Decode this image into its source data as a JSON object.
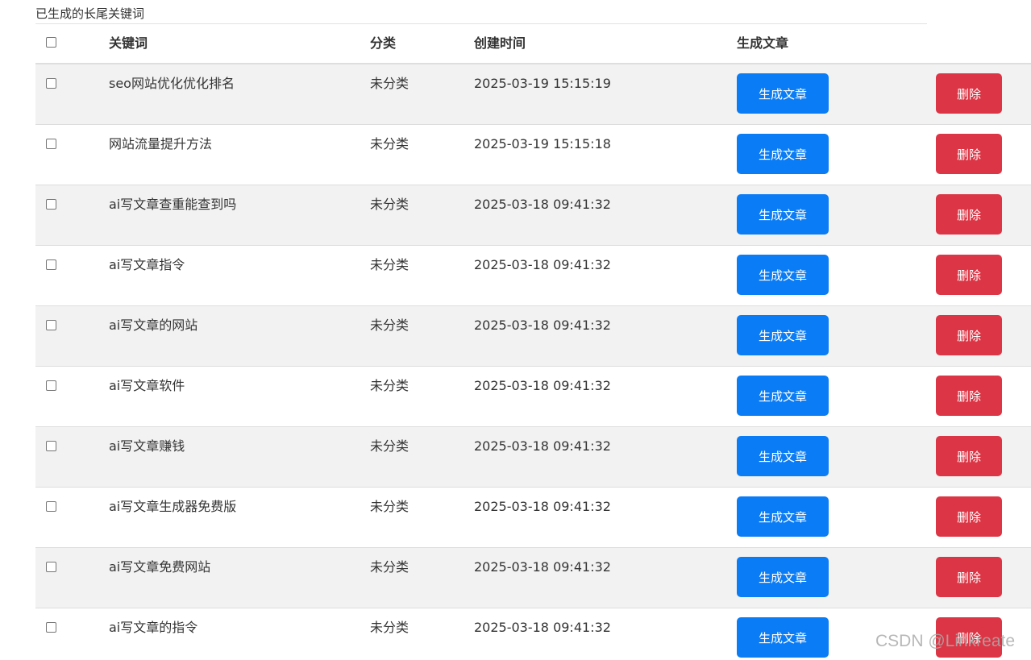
{
  "caption": "已生成的长尾关键词",
  "header": {
    "keyword": "关键词",
    "category": "分类",
    "created": "创建时间",
    "generate": "生成文章"
  },
  "rows": [
    {
      "keyword": "seo网站优化优化排名",
      "category": "未分类",
      "created": "2025-03-19 15:15:19",
      "gen_label": "生成文章",
      "del_label": "删除"
    },
    {
      "keyword": "网站流量提升方法",
      "category": "未分类",
      "created": "2025-03-19 15:15:18",
      "gen_label": "生成文章",
      "del_label": "删除"
    },
    {
      "keyword": "ai写文章查重能查到吗",
      "category": "未分类",
      "created": "2025-03-18 09:41:32",
      "gen_label": "生成文章",
      "del_label": "删除"
    },
    {
      "keyword": "ai写文章指令",
      "category": "未分类",
      "created": "2025-03-18 09:41:32",
      "gen_label": "生成文章",
      "del_label": "删除"
    },
    {
      "keyword": "ai写文章的网站",
      "category": "未分类",
      "created": "2025-03-18 09:41:32",
      "gen_label": "生成文章",
      "del_label": "删除"
    },
    {
      "keyword": "ai写文章软件",
      "category": "未分类",
      "created": "2025-03-18 09:41:32",
      "gen_label": "生成文章",
      "del_label": "删除"
    },
    {
      "keyword": "ai写文章赚钱",
      "category": "未分类",
      "created": "2025-03-18 09:41:32",
      "gen_label": "生成文章",
      "del_label": "删除"
    },
    {
      "keyword": "ai写文章生成器免费版",
      "category": "未分类",
      "created": "2025-03-18 09:41:32",
      "gen_label": "生成文章",
      "del_label": "删除"
    },
    {
      "keyword": "ai写文章免费网站",
      "category": "未分类",
      "created": "2025-03-18 09:41:32",
      "gen_label": "生成文章",
      "del_label": "删除"
    },
    {
      "keyword": "ai写文章的指令",
      "category": "未分类",
      "created": "2025-03-18 09:41:32",
      "gen_label": "生成文章",
      "del_label": "删除"
    }
  ],
  "colors": {
    "generate_button": "#0a7cf5",
    "delete_button": "#dc3545",
    "striped_row": "#f2f2f2"
  },
  "watermark": "CSDN @Linkreate"
}
